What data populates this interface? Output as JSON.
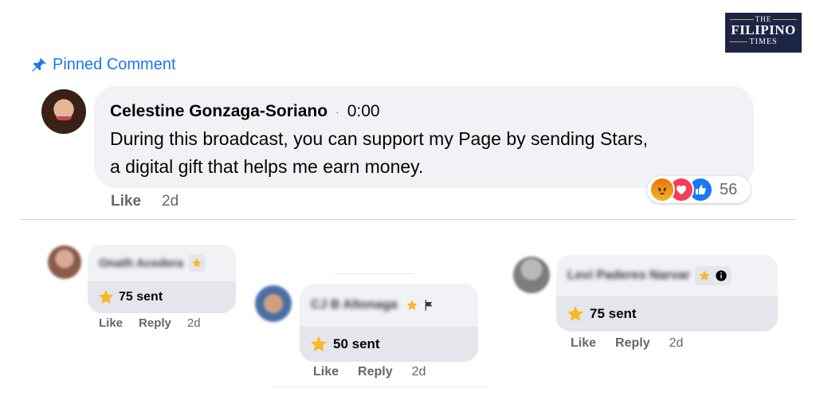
{
  "logo": {
    "line1": "THE",
    "line2": "FILIPINO",
    "line3": "TIMES"
  },
  "pinned": {
    "label": "Pinned Comment",
    "icon": "pin-icon"
  },
  "main_comment": {
    "author": "Celestine Gonzaga-Soriano",
    "separator": "·",
    "timestamp": "0:00",
    "text_line1": "During this broadcast, you can support my Page by sending Stars,",
    "text_line2": "a digital gift that helps me earn money.",
    "reaction_icons": [
      "angry-icon",
      "love-icon",
      "like-icon"
    ],
    "reaction_count": "56",
    "like_label": "Like",
    "age": "2d"
  },
  "star_comments": [
    {
      "name": "Onath Acedera",
      "sent": "75 sent",
      "like": "Like",
      "reply": "Reply",
      "age": "2d"
    },
    {
      "name": "CJ B Altonaga",
      "sent": "50 sent",
      "like": "Like",
      "reply": "Reply",
      "age": "2d"
    },
    {
      "name": "Levi Paderes Narvar",
      "sent": "75 sent",
      "like": "Like",
      "reply": "Reply",
      "age": "2d"
    }
  ],
  "colors": {
    "accent": "#1877f2",
    "star": "#f7b928",
    "bubble": "#f0f2f5",
    "logo_bg": "#1d2547"
  }
}
